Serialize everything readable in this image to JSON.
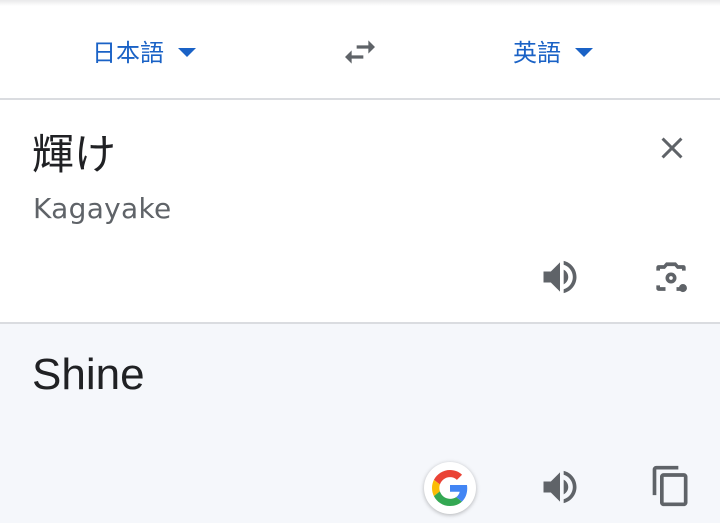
{
  "language_bar": {
    "source_language": "日本語",
    "target_language": "英語"
  },
  "source": {
    "text": "輝け",
    "romanization": "Kagayake"
  },
  "result": {
    "text": "Shine"
  },
  "icons": {
    "swap": "swap-arrows-icon",
    "clear": "close-icon",
    "listen": "speaker-icon",
    "camera": "camera-icon",
    "google": "google-logo-icon",
    "copy": "copy-icon"
  },
  "colors": {
    "accent": "#1a62c6",
    "icon_gray": "#5f6368",
    "result_bg": "#f5f7fb",
    "divider": "#dadce0"
  }
}
